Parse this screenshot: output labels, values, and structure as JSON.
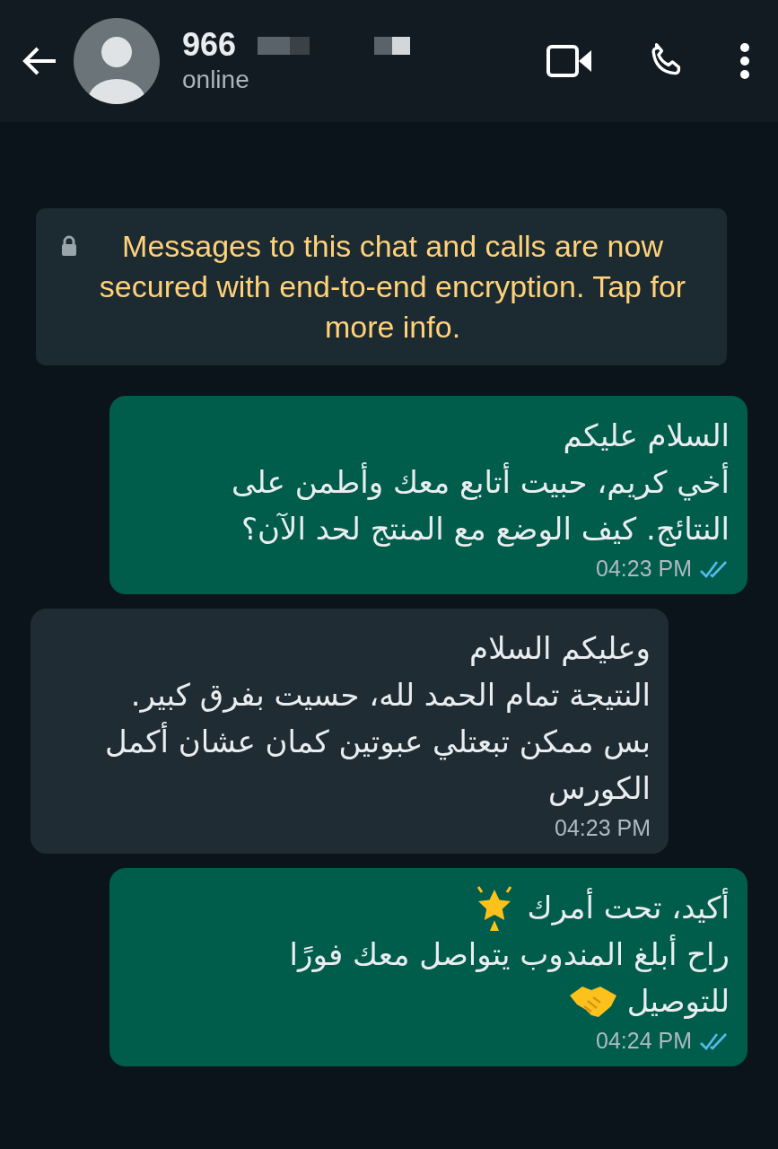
{
  "header": {
    "name": "966",
    "status": "online"
  },
  "notice": {
    "text": "Messages to this chat and calls are now secured with end-to-end encryption. Tap for more info."
  },
  "messages": [
    {
      "kind": "outgoing",
      "lines": [
        {
          "text": "السلام عليكم"
        },
        {
          "text": "أخي كريم، حبيت أتابع معك وأطمن على"
        },
        {
          "text": "النتائج. كيف الوضع مع المنتج لحد الآن؟"
        }
      ],
      "time": "04:23 PM",
      "read": true
    },
    {
      "kind": "incoming",
      "lines": [
        {
          "text": "وعليكم السلام"
        },
        {
          "text": "النتيجة تمام الحمد لله، حسيت بفرق كبير."
        },
        {
          "text": "بس ممكن تبعتلي عبوتين كمان عشان أكمل"
        },
        {
          "text": "الكورس"
        }
      ],
      "time": "04:23 PM"
    },
    {
      "kind": "outgoing",
      "lines": [
        {
          "text": "أكيد، تحت أمرك",
          "kind": "star"
        },
        {
          "text": "راح أبلغ المندوب يتواصل معك فورًا"
        },
        {
          "text": "للتوصيل",
          "kind": "handshake"
        }
      ],
      "time": "04:24 PM",
      "read": true
    }
  ]
}
